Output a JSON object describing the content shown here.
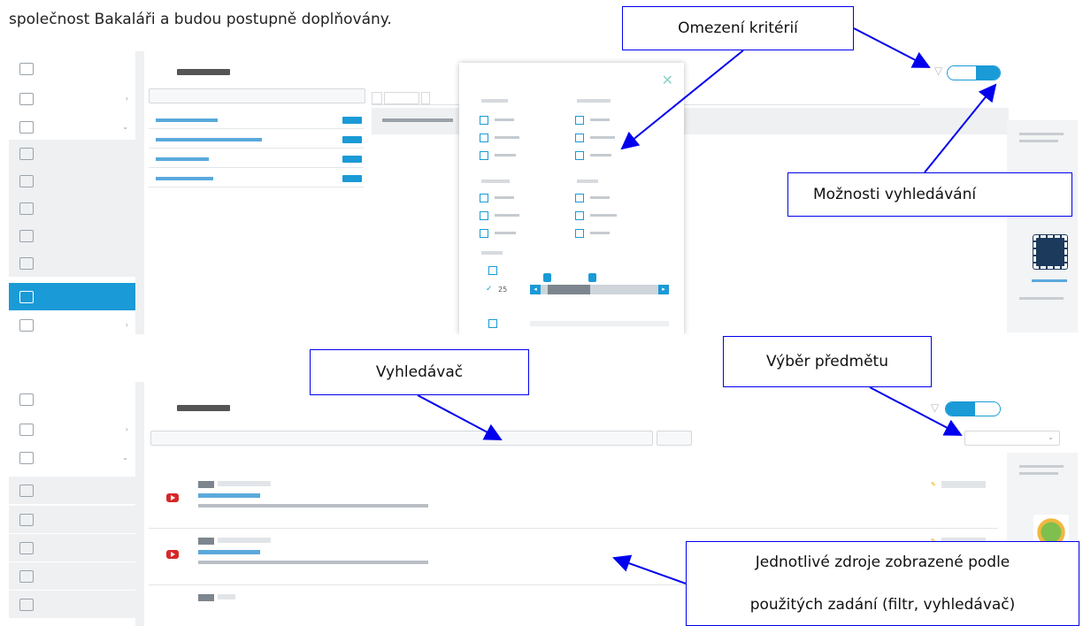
{
  "intro_text": "společnost Bakaláři a budou postupně doplňovány.",
  "callouts": {
    "criteria": "Omezení kritérií",
    "search_options": "Možnosti vyhledávání",
    "searcher": "Vyhledávač",
    "subject": "Výběr předmětu",
    "resources_line1": "Jednotlivé zdroje zobrazené podle",
    "resources_line2": "použitých zadání (filtr, vyhledávač)"
  },
  "popup": {
    "close": "✕",
    "age_value": "25"
  },
  "colors": {
    "accent": "#1a9ad6",
    "callout_border": "#0000ee",
    "sidebar_active": "#1a9ad6",
    "youtube": "#d62828"
  },
  "icons": [
    "close-icon",
    "filter-icon",
    "youtube-icon",
    "chevron-down-icon",
    "chevron-right-icon",
    "pencil-icon"
  ]
}
